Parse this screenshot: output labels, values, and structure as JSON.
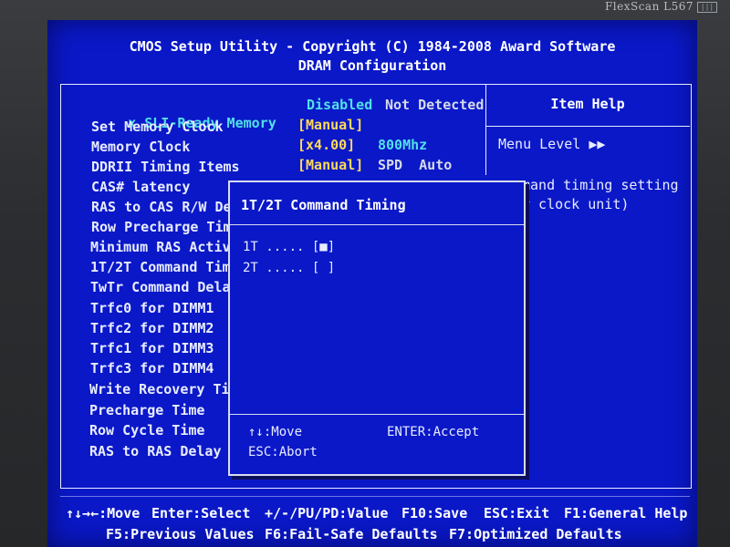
{
  "monitor": {
    "brand": "FlexScan L567",
    "badge": "|||"
  },
  "header": {
    "line1": "CMOS Setup Utility - Copyright (C) 1984-2008 Award Software",
    "line2": "DRAM Configuration"
  },
  "items": [
    {
      "prefix": "x",
      "label": "SLI-Ready Memory",
      "value": "Disabled",
      "extra": "Not Detected"
    },
    {
      "prefix": "",
      "label": "Set Memory Clock",
      "value": "[Manual]"
    },
    {
      "prefix": "",
      "label": "Memory Clock",
      "value": "[x4.00]",
      "extra": "800Mhz"
    },
    {
      "prefix": "",
      "label": "DDRII Timing Items",
      "value": "[Manual]",
      "extra": "SPD  Auto"
    },
    {
      "prefix": "",
      "label": "CAS# latency"
    },
    {
      "prefix": "",
      "label": "RAS to CAS R/W De"
    },
    {
      "prefix": "",
      "label": "Row Precharge Tim"
    },
    {
      "prefix": "",
      "label": "Minimum RAS Activ"
    },
    {
      "prefix": "",
      "label": "1T/2T Command Tim"
    },
    {
      "prefix": "",
      "label": "TwTr Command Dela"
    },
    {
      "prefix": "",
      "label": "Trfc0 for DIMM1"
    },
    {
      "prefix": "",
      "label": "Trfc2 for DIMM2"
    },
    {
      "prefix": "",
      "label": "Trfc1 for DIMM3"
    },
    {
      "prefix": "",
      "label": "Trfc3 for DIMM4"
    },
    {
      "prefix": "",
      "label": "Write Recovery Ti"
    },
    {
      "prefix": "",
      "label": "Precharge Time"
    },
    {
      "prefix": "",
      "label": "Row Cycle Time"
    },
    {
      "prefix": "",
      "label": "RAS to RAS Delay"
    }
  ],
  "help": {
    "title": "Item Help",
    "menu_level": "Menu Level   ▶▶",
    "text1": "mand timing setting",
    "text2": "r clock unit)"
  },
  "popup": {
    "title": "1T/2T Command Timing",
    "options": [
      {
        "label": "1T ..... [■]",
        "selected": true
      },
      {
        "label": "2T ..... [ ]",
        "selected": false
      }
    ],
    "hint_move": "↑↓:Move",
    "hint_accept": "ENTER:Accept",
    "hint_abort": "ESC:Abort"
  },
  "footer": {
    "line1": [
      "↑↓→←:Move",
      "Enter:Select",
      "+/-/PU/PD:Value",
      "F10:Save",
      "ESC:Exit",
      "F1:General Help"
    ],
    "line2": [
      "F5:Previous Values",
      "F6:Fail-Safe Defaults",
      "F7:Optimized Defaults"
    ]
  }
}
